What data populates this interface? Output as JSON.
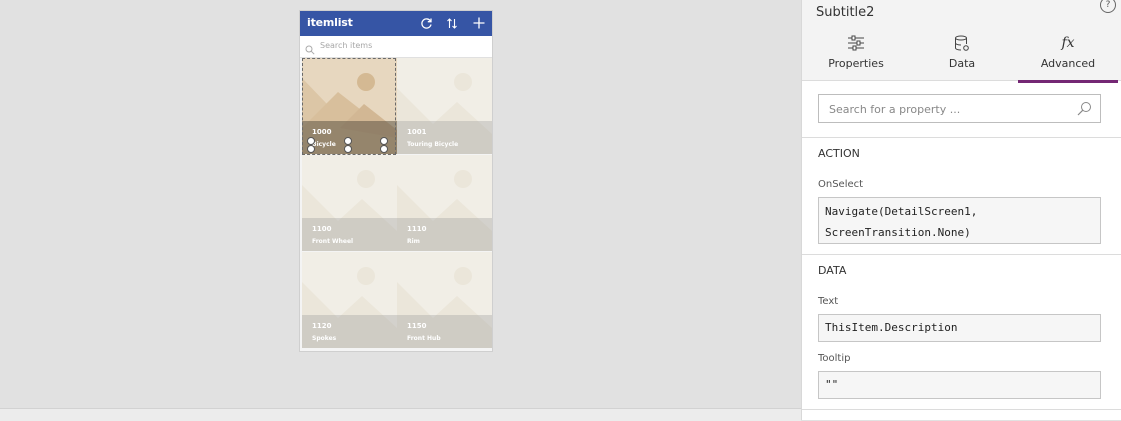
{
  "app": {
    "title": "itemlist",
    "search_placeholder": "Search items",
    "icons": [
      "refresh-icon",
      "sort-icon",
      "add-icon"
    ]
  },
  "gallery": {
    "items": [
      {
        "id": "1000",
        "name": "Bicycle",
        "selected": true
      },
      {
        "id": "1001",
        "name": "Touring Bicycle",
        "selected": false
      },
      {
        "id": "1100",
        "name": "Front Wheel",
        "selected": false
      },
      {
        "id": "1110",
        "name": "Rim",
        "selected": false
      },
      {
        "id": "1120",
        "name": "Spokes",
        "selected": false
      },
      {
        "id": "1150",
        "name": "Front Hub",
        "selected": false
      }
    ]
  },
  "panel": {
    "title": "Subtitle2",
    "help": "?",
    "tabs": [
      {
        "label": "Properties",
        "icon": "sliders-icon",
        "active": false
      },
      {
        "label": "Data",
        "icon": "database-icon",
        "active": false
      },
      {
        "label": "Advanced",
        "icon": "fx-icon",
        "active": true
      }
    ],
    "search_placeholder": "Search for a property ...",
    "sections": {
      "action": {
        "title": "ACTION",
        "onselect_label": "OnSelect",
        "onselect_line1": "Navigate(DetailScreen1,",
        "onselect_line2": "ScreenTransition.None)"
      },
      "data": {
        "title": "DATA",
        "text_label": "Text",
        "text_value": "ThisItem.Description",
        "tooltip_label": "Tooltip",
        "tooltip_value": "\"\""
      }
    }
  },
  "colors": {
    "appbar": "#3655a5",
    "active_tab": "#742774",
    "canvas": "#e1e1e1"
  }
}
